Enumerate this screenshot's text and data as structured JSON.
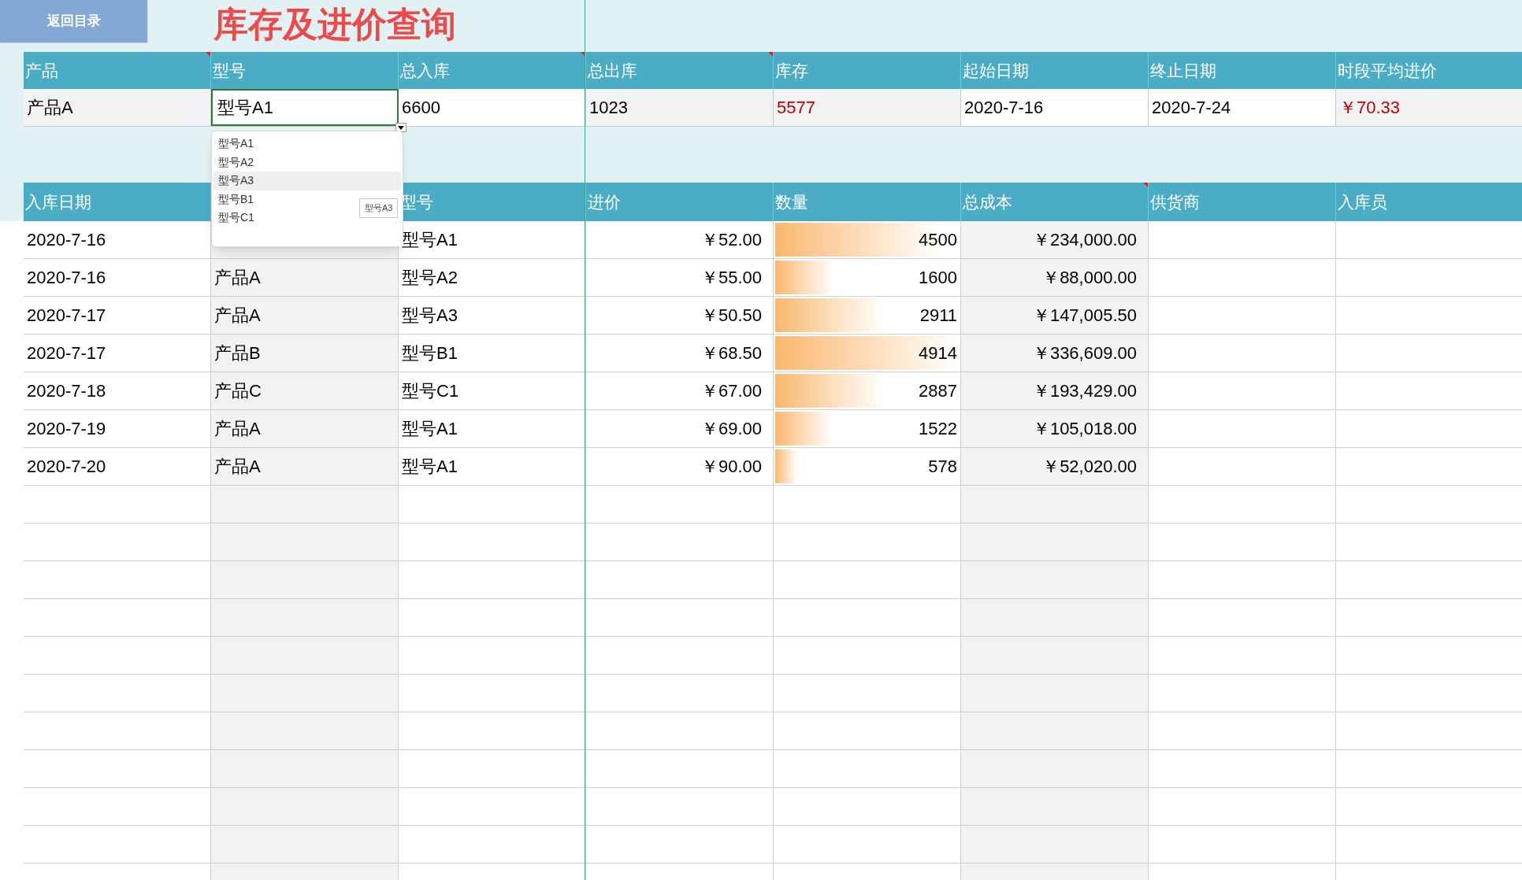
{
  "back_button": "返回目录",
  "title": "库存及进价查询",
  "summary": {
    "columns": [
      {
        "label": "产品",
        "note": true
      },
      {
        "label": "型号",
        "note": false
      },
      {
        "label": "总入库",
        "note": true
      },
      {
        "label": "总出库",
        "note": true
      },
      {
        "label": "库存",
        "note": false
      },
      {
        "label": "起始日期",
        "note": false
      },
      {
        "label": "终止日期",
        "note": false
      },
      {
        "label": "时段平均进价",
        "note": false
      }
    ],
    "values": [
      {
        "text": "产品A",
        "kind": "plain"
      },
      {
        "text": "型号A1",
        "kind": "input"
      },
      {
        "text": "6600",
        "kind": "plain"
      },
      {
        "text": "1023",
        "kind": "plain"
      },
      {
        "text": "5577",
        "kind": "alert"
      },
      {
        "text": "2020-7-16",
        "kind": "plain"
      },
      {
        "text": "2020-7-24",
        "kind": "plain"
      },
      {
        "text": "￥70.33",
        "kind": "alert"
      }
    ]
  },
  "dropdown": {
    "items": [
      {
        "label": "型号A1",
        "selected": false
      },
      {
        "label": "型号A2",
        "selected": false
      },
      {
        "label": "型号A3",
        "selected": true
      },
      {
        "label": "型号B1",
        "selected": false
      },
      {
        "label": "型号C1",
        "selected": false
      }
    ],
    "tooltip": "型号A3"
  },
  "table": {
    "columns": [
      {
        "label": "入库日期",
        "note": false
      },
      {
        "label": "型号",
        "note": false
      },
      {
        "label": "进价",
        "note": false
      },
      {
        "label": "数量",
        "note": false
      },
      {
        "label": "总成本",
        "note": true
      },
      {
        "label": "供货商",
        "note": false
      },
      {
        "label": "入库员",
        "note": false
      }
    ],
    "rows": [
      {
        "date": "2020-7-16",
        "model": "型号A1",
        "price": "￥52.00",
        "qty": "4500",
        "level": 0.9,
        "cost": "￥234,000.00"
      },
      {
        "date": "2020-7-16",
        "product": "产品A",
        "model": "型号A2",
        "price": "￥55.00",
        "qty": "1600",
        "level": 0.32,
        "cost": "￥88,000.00"
      },
      {
        "date": "2020-7-17",
        "product": "产品A",
        "model": "型号A3",
        "price": "￥50.50",
        "qty": "2911",
        "level": 0.59,
        "cost": "￥147,005.50"
      },
      {
        "date": "2020-7-17",
        "product": "产品B",
        "model": "型号B1",
        "price": "￥68.50",
        "qty": "4914",
        "level": 1.0,
        "cost": "￥336,609.00"
      },
      {
        "date": "2020-7-18",
        "product": "产品C",
        "model": "型号C1",
        "price": "￥67.00",
        "qty": "2887",
        "level": 0.59,
        "cost": "￥193,429.00"
      },
      {
        "date": "2020-7-19",
        "product": "产品A",
        "model": "型号A1",
        "price": "￥69.00",
        "qty": "1522",
        "level": 0.31,
        "cost": "￥105,018.00"
      },
      {
        "date": "2020-7-20",
        "product": "产品A",
        "model": "型号A1",
        "price": "￥90.00",
        "qty": "578",
        "level": 0.12,
        "cost": "￥52,020.00"
      }
    ]
  }
}
